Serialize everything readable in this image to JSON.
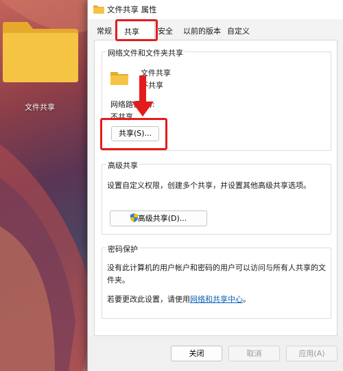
{
  "desktop": {
    "folder_label": "文件共享"
  },
  "window": {
    "title": "文件共享 属性"
  },
  "tabs": [
    {
      "label": "常规"
    },
    {
      "label": "共享"
    },
    {
      "label": "安全"
    },
    {
      "label": "以前的版本"
    },
    {
      "label": "自定义"
    }
  ],
  "sharing": {
    "group_title": "网络文件和文件夹共享",
    "folder_name": "文件共享",
    "folder_status": "不共享",
    "network_path_label": "网络路径(N):",
    "network_path_value": "不共享",
    "share_button": "共享(S)..."
  },
  "advanced": {
    "group_title": "高级共享",
    "description": "设置自定义权限，创建多个共享，并设置其他高级共享选项。",
    "button": "高级共享(D)..."
  },
  "password": {
    "group_title": "密码保护",
    "description_line1": "没有此计算机的用户帐户和密码的用户可以访问与所有人共享的文",
    "description_line2": "件夹。",
    "change_prefix": "若要更改此设置，请使用",
    "link_text": "网络和共享中心",
    "change_suffix": "。"
  },
  "footer": {
    "close": "关闭",
    "cancel": "取消",
    "apply": "应用(A)"
  },
  "colors": {
    "highlight": "#e51b1b",
    "link": "#0a5fb4",
    "folder": "#f6c443"
  },
  "icons": {
    "folder": "folder-icon",
    "shield": "uac-shield-icon",
    "arrow": "red-arrow-annotation"
  }
}
